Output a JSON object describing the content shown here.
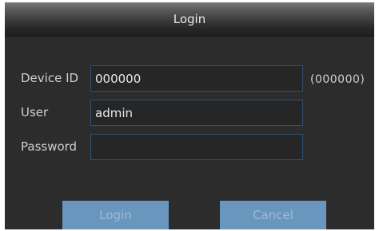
{
  "dialog": {
    "title": "Login"
  },
  "form": {
    "device_id": {
      "label": "Device ID",
      "value": "000000",
      "hint": "(000000)"
    },
    "user": {
      "label": "User",
      "value": "admin"
    },
    "password": {
      "label": "Password",
      "value": ""
    }
  },
  "buttons": {
    "login_label": "Login",
    "cancel_label": "Cancel"
  },
  "colors": {
    "dialog_background": "#2c2c2c",
    "field_border": "#2f5277",
    "button_background": "#6996bd",
    "button_text": "#9fbbd5"
  }
}
